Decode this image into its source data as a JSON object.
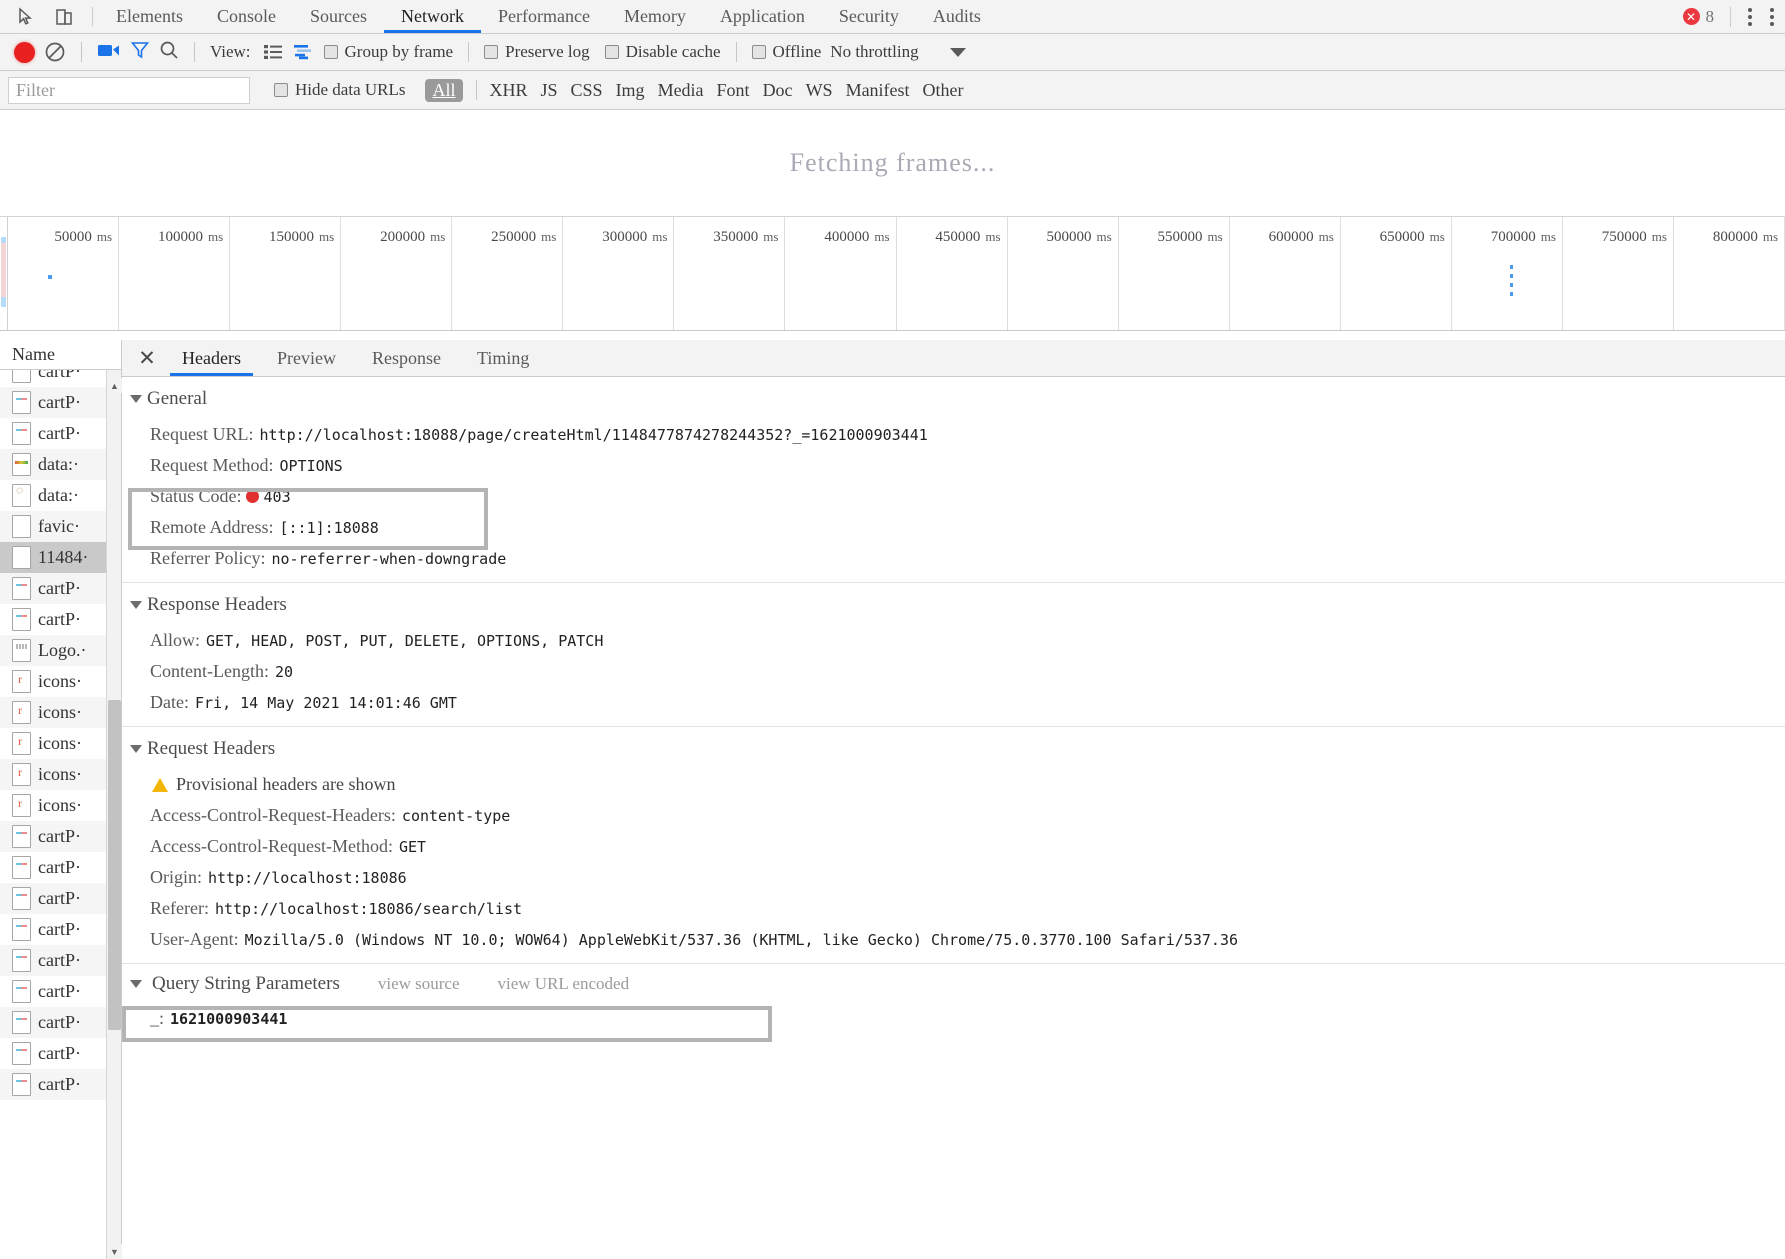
{
  "window": {
    "error_badge_count": "8"
  },
  "panel_tabs": [
    {
      "label": "Elements",
      "selected": false
    },
    {
      "label": "Console",
      "selected": false
    },
    {
      "label": "Sources",
      "selected": false
    },
    {
      "label": "Network",
      "selected": true
    },
    {
      "label": "Performance",
      "selected": false
    },
    {
      "label": "Memory",
      "selected": false
    },
    {
      "label": "Application",
      "selected": false
    },
    {
      "label": "Security",
      "selected": false
    },
    {
      "label": "Audits",
      "selected": false
    }
  ],
  "network_toolbar": {
    "view_label": "View:",
    "group_by_frame": "Group by frame",
    "preserve_log": "Preserve log",
    "disable_cache": "Disable cache",
    "offline": "Offline",
    "throttling": "No throttling"
  },
  "filter_bar": {
    "filter_placeholder": "Filter",
    "hide_data_urls": "Hide data URLs",
    "types": [
      "All",
      "XHR",
      "JS",
      "CSS",
      "Img",
      "Media",
      "Font",
      "Doc",
      "WS",
      "Manifest",
      "Other"
    ],
    "active_type": "All"
  },
  "overview": {
    "message": "Fetching frames..."
  },
  "timeline": {
    "ticks": [
      {
        "value": "50000",
        "unit": "ms"
      },
      {
        "value": "100000",
        "unit": "ms"
      },
      {
        "value": "150000",
        "unit": "ms"
      },
      {
        "value": "200000",
        "unit": "ms"
      },
      {
        "value": "250000",
        "unit": "ms"
      },
      {
        "value": "300000",
        "unit": "ms"
      },
      {
        "value": "350000",
        "unit": "ms"
      },
      {
        "value": "400000",
        "unit": "ms"
      },
      {
        "value": "450000",
        "unit": "ms"
      },
      {
        "value": "500000",
        "unit": "ms"
      },
      {
        "value": "550000",
        "unit": "ms"
      },
      {
        "value": "600000",
        "unit": "ms"
      },
      {
        "value": "650000",
        "unit": "ms"
      },
      {
        "value": "700000",
        "unit": "ms"
      },
      {
        "value": "750000",
        "unit": "ms"
      },
      {
        "value": "800000",
        "unit": "ms"
      }
    ]
  },
  "sidebar": {
    "column_header": "Name",
    "rows": [
      {
        "label": "cartP·",
        "icon": "doc",
        "selected": false,
        "partial": true
      },
      {
        "label": "cartP·",
        "icon": "doc",
        "selected": false
      },
      {
        "label": "cartP·",
        "icon": "doc",
        "selected": false
      },
      {
        "label": "data:·",
        "icon": "data",
        "selected": false
      },
      {
        "label": "data:·",
        "icon": "img",
        "selected": false
      },
      {
        "label": "favic·",
        "icon": "blank",
        "selected": false
      },
      {
        "label": "11484·",
        "icon": "blank",
        "selected": true
      },
      {
        "label": "cartP·",
        "icon": "doc",
        "selected": false
      },
      {
        "label": "cartP·",
        "icon": "doc",
        "selected": false
      },
      {
        "label": "Logo.·",
        "icon": "logo",
        "selected": false
      },
      {
        "label": "icons·",
        "icon": "ico-r",
        "selected": false
      },
      {
        "label": "icons·",
        "icon": "ico-r",
        "selected": false
      },
      {
        "label": "icons·",
        "icon": "ico-r",
        "selected": false
      },
      {
        "label": "icons·",
        "icon": "ico-r",
        "selected": false
      },
      {
        "label": "icons·",
        "icon": "ico-r",
        "selected": false
      },
      {
        "label": "cartP·",
        "icon": "doc",
        "selected": false
      },
      {
        "label": "cartP·",
        "icon": "doc",
        "selected": false
      },
      {
        "label": "cartP·",
        "icon": "doc",
        "selected": false
      },
      {
        "label": "cartP·",
        "icon": "doc",
        "selected": false
      },
      {
        "label": "cartP·",
        "icon": "doc",
        "selected": false
      },
      {
        "label": "cartP·",
        "icon": "doc",
        "selected": false
      },
      {
        "label": "cartP·",
        "icon": "doc",
        "selected": false
      },
      {
        "label": "cartP·",
        "icon": "doc",
        "selected": false
      },
      {
        "label": "cartP·",
        "icon": "doc",
        "selected": false
      }
    ]
  },
  "details": {
    "tabs": [
      {
        "label": "Headers",
        "selected": true
      },
      {
        "label": "Preview",
        "selected": false
      },
      {
        "label": "Response",
        "selected": false
      },
      {
        "label": "Timing",
        "selected": false
      }
    ],
    "general": {
      "title": "General",
      "rows": [
        {
          "name": "Request URL:",
          "value": "http://localhost:18088/page/createHtml/1148477874278244352?_=1621000903441"
        },
        {
          "name": "Request Method:",
          "value": "OPTIONS"
        },
        {
          "name": "Status Code:",
          "value": "403",
          "status": true
        },
        {
          "name": "Remote Address:",
          "value": "[::1]:18088"
        },
        {
          "name": "Referrer Policy:",
          "value": "no-referrer-when-downgrade"
        }
      ]
    },
    "response_headers": {
      "title": "Response Headers",
      "rows": [
        {
          "name": "Allow:",
          "value": "GET, HEAD, POST, PUT, DELETE, OPTIONS, PATCH"
        },
        {
          "name": "Content-Length:",
          "value": "20"
        },
        {
          "name": "Date:",
          "value": "Fri, 14 May 2021 14:01:46 GMT"
        }
      ]
    },
    "request_headers": {
      "title": "Request Headers",
      "provisional_notice": "Provisional headers are shown",
      "rows": [
        {
          "name": "Access-Control-Request-Headers:",
          "value": "content-type"
        },
        {
          "name": "Access-Control-Request-Method:",
          "value": "GET"
        },
        {
          "name": "Origin:",
          "value": "http://localhost:18086"
        },
        {
          "name": "Referer:",
          "value": "http://localhost:18086/search/list"
        },
        {
          "name": "User-Agent:",
          "value": "Mozilla/5.0 (Windows NT 10.0; WOW64) AppleWebKit/537.36 (KHTML, like Gecko) Chrome/75.0.3770.100 Safari/537.36"
        }
      ]
    },
    "query_string": {
      "title": "Query String Parameters",
      "view_source": "view source",
      "view_url_encoded": "view URL encoded",
      "rows": [
        {
          "name": "_:",
          "value": "1621000903441"
        }
      ]
    }
  },
  "colors": {
    "accent": "#1a73e8",
    "error": "#e03030",
    "warning": "#f2b705",
    "record": "#e8201f"
  }
}
